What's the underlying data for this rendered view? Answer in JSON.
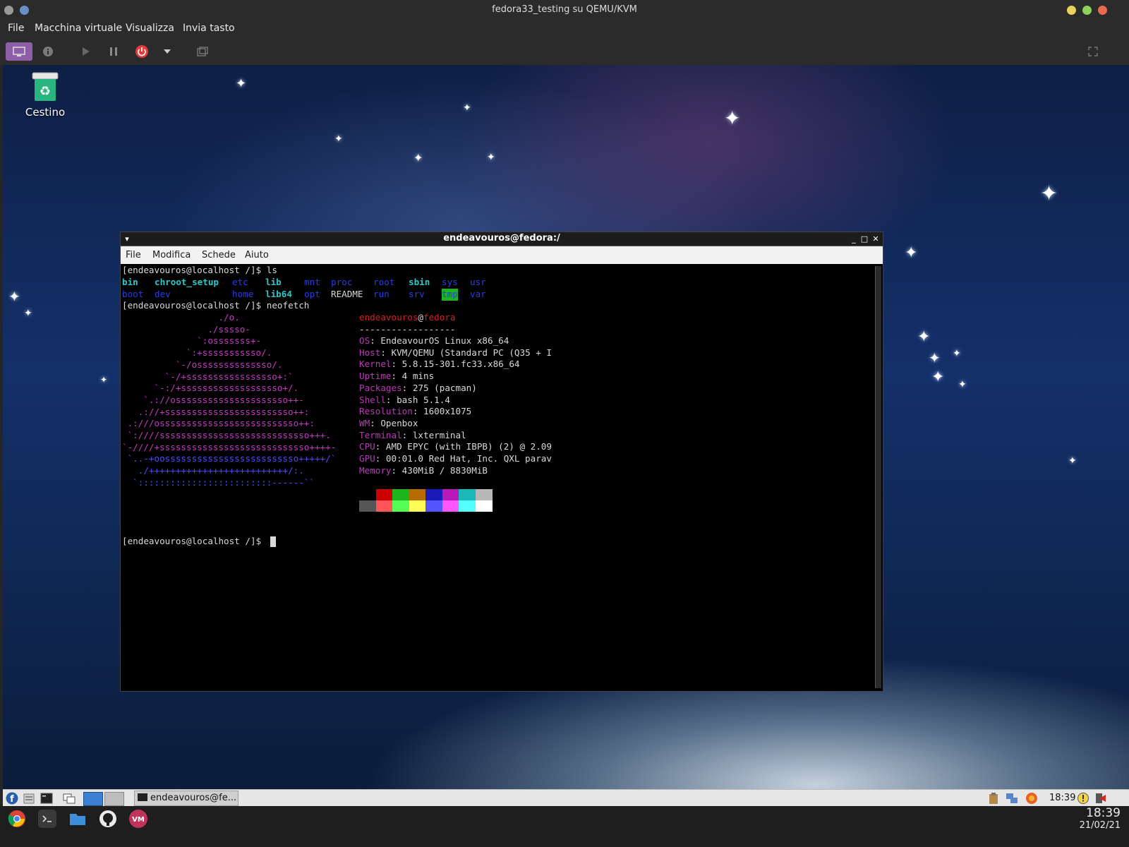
{
  "host_window": {
    "title": "fedora33_testing su QEMU/KVM",
    "menu": [
      "File",
      "Macchina virtuale",
      "Visualizza",
      "Invia tasto"
    ],
    "toolbar_icons": [
      "console-icon",
      "info-icon",
      "play-icon",
      "pause-icon",
      "power-icon",
      "dropdown-icon",
      "snapshot-icon",
      "fullscreen-icon"
    ]
  },
  "desktop": {
    "trash_label": "Cestino"
  },
  "terminal": {
    "title": "endeavouros@fedora:/",
    "menu": [
      "File",
      "Modifica",
      "Schede",
      "Aiuto"
    ],
    "prompt": "[endeavouros@localhost /]$",
    "cmd1": "ls",
    "cmd2": "neofetch",
    "ls_row1": [
      "bin",
      "chroot_setup",
      "etc",
      "lib",
      "mnt",
      "proc",
      "root",
      "sbin",
      "sys",
      "usr"
    ],
    "ls_row2": [
      "boot",
      "dev",
      "home",
      "lib64",
      "opt",
      "README",
      "run",
      "srv",
      "tmp",
      "var"
    ],
    "logo": [
      "                  ./o.",
      "                ./sssso-",
      "              `:osssssss+-",
      "            `:+sssssssssso/.",
      "          `-/ossssssssssssso/.",
      "        `-/+sssssssssssssssso+:`",
      "      `-:/+sssssssssssssssssso+/.",
      "    `.://osssssssssssssssssssso++-",
      "   .://+ssssssssssssssssssssssso++:",
      " .:///ossssssssssssssssssssssssso++:",
      " `:////ssssssssssssssssssssssssssso+++.",
      "`-////+ssssssssssssssssssssssssssso++++-",
      " `..-+oosssssssssssssssssssssssso+++++/`",
      "   ./++++++++++++++++++++++++++/:.",
      "  `:::::::::::::::::::::::::------``"
    ],
    "nf_user": "endeavouros",
    "nf_at": "@",
    "nf_host": "fedora",
    "nf_sep": "------------------",
    "nf_info": [
      {
        "key": "OS",
        "value": "EndeavourOS Linux x86_64"
      },
      {
        "key": "Host",
        "value": "KVM/QEMU (Standard PC (Q35 + I"
      },
      {
        "key": "Kernel",
        "value": "5.8.15-301.fc33.x86_64"
      },
      {
        "key": "Uptime",
        "value": "4 mins"
      },
      {
        "key": "Packages",
        "value": "275 (pacman)"
      },
      {
        "key": "Shell",
        "value": "bash 5.1.4"
      },
      {
        "key": "Resolution",
        "value": "1600x1075"
      },
      {
        "key": "WM",
        "value": "Openbox"
      },
      {
        "key": "Terminal",
        "value": "lxterminal"
      },
      {
        "key": "CPU",
        "value": "AMD EPYC (with IBPB) (2) @ 2.09"
      },
      {
        "key": "GPU",
        "value": "00:01.0 Red Hat, Inc. QXL parav"
      },
      {
        "key": "Memory",
        "value": "430MiB / 8830MiB"
      }
    ],
    "palette_top": [
      "#000000",
      "#cc0000",
      "#1cb51c",
      "#b86b00",
      "#1a1ab8",
      "#b81ab8",
      "#1ab8b8",
      "#b8b8b8"
    ],
    "palette_bottom": [
      "#555555",
      "#ff5555",
      "#55ff55",
      "#ffff55",
      "#5555ff",
      "#ff55ff",
      "#55ffff",
      "#ffffff"
    ]
  },
  "panel": {
    "task_label": "endeavouros@fe...",
    "clock": "18:39"
  },
  "dock": {
    "clock": "18:39",
    "date": "21/02/21"
  }
}
